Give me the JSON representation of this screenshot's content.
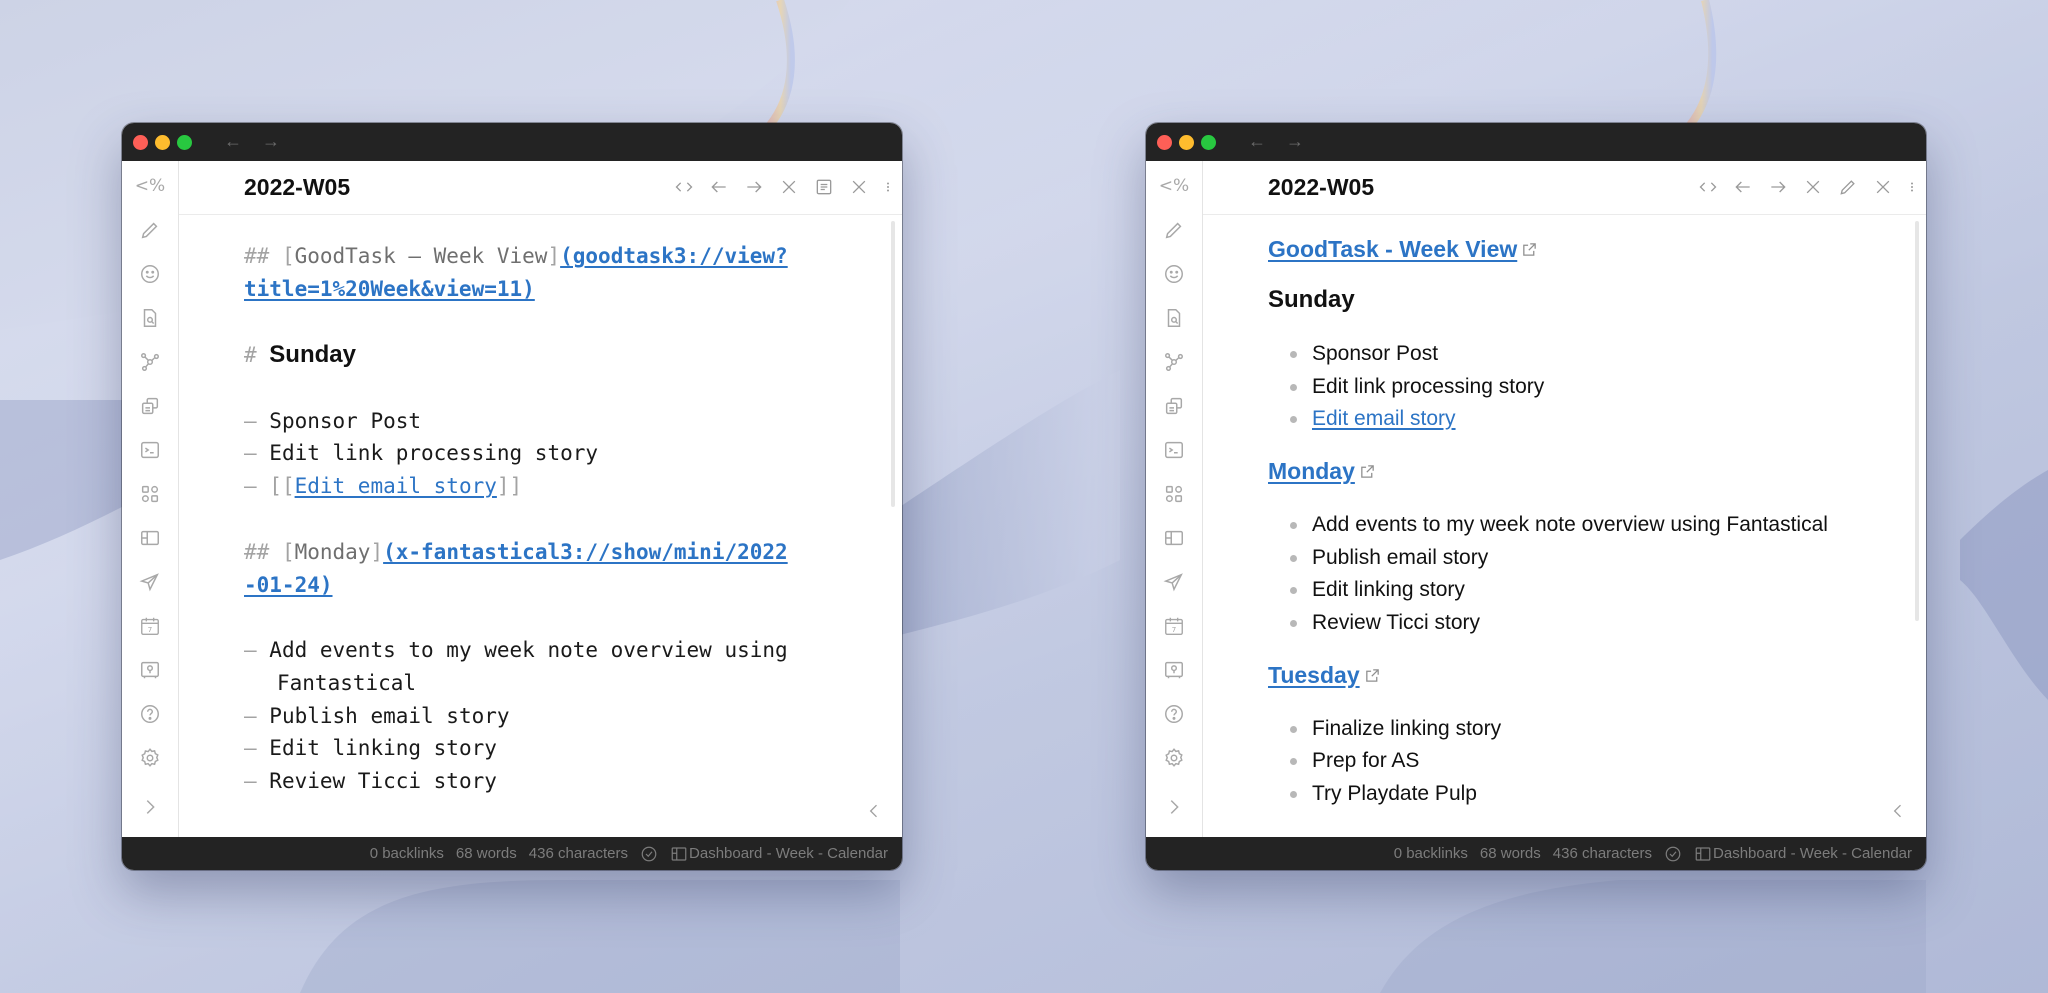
{
  "windows": [
    {
      "mode": "source",
      "titlebar": {
        "back": "←",
        "forward": "→"
      },
      "note_title": "2022-W05",
      "header_actions": [
        "code-toggle",
        "back",
        "forward",
        "close",
        "reading-view",
        "close",
        "more"
      ],
      "source_lines": {
        "l1_prefix": "## ",
        "l1_open": "[",
        "l1_text": "GoodTask – Week View",
        "l1_close": "]",
        "l1_url_a": "(goodtask3://view?",
        "l2_url_b": "title=1%20Week&view=11)",
        "h1_marker": "# ",
        "h1_text": "Sunday",
        "dash": "– ",
        "sun_items": [
          "Sponsor Post",
          "Edit link processing story"
        ],
        "wikilink_open": "[[",
        "wikilink_text": "Edit email story",
        "wikilink_close": "]]",
        "mon_prefix": "## ",
        "mon_open": "[",
        "mon_text": "Monday",
        "mon_close": "]",
        "mon_url_a": "(x-fantastical3://show/mini/2022",
        "mon_url_b": "-01-24)",
        "mon_items": [
          "Add events to my week note overview using",
          "Fantastical",
          "Publish email story",
          "Edit linking story",
          "Review Ticci story"
        ]
      }
    },
    {
      "mode": "preview",
      "titlebar": {
        "back": "←",
        "forward": "→"
      },
      "note_title": "2022-W05",
      "header_actions": [
        "code-toggle",
        "back",
        "forward",
        "close",
        "edit",
        "close",
        "more"
      ],
      "preview": {
        "goodtask_link": "GoodTask - Week View",
        "sunday_heading": "Sunday",
        "sunday_items": [
          "Sponsor Post",
          "Edit link processing story"
        ],
        "sunday_link_item": "Edit email story",
        "monday_heading": "Monday",
        "monday_items": [
          "Add events to my week note overview using Fantastical",
          "Publish email story",
          "Edit linking story",
          "Review Ticci story"
        ],
        "tuesday_heading": "Tuesday",
        "tuesday_items": [
          "Finalize linking story",
          "Prep for AS",
          "Try Playdate Pulp"
        ]
      }
    }
  ],
  "sidebar": {
    "items": [
      {
        "icon": "templater-icon",
        "label": "<%"
      },
      {
        "icon": "pencil-icon"
      },
      {
        "icon": "smiley-icon"
      },
      {
        "icon": "file-search-icon"
      },
      {
        "icon": "graph-icon"
      },
      {
        "icon": "copy-icon"
      },
      {
        "icon": "terminal-icon"
      },
      {
        "icon": "apps-icon"
      },
      {
        "icon": "layout-icon"
      },
      {
        "icon": "send-icon"
      },
      {
        "icon": "calendar-icon",
        "label": "7"
      },
      {
        "icon": "vault-icon"
      },
      {
        "icon": "help-icon"
      },
      {
        "icon": "settings-icon"
      },
      {
        "icon": "expand-icon"
      }
    ]
  },
  "status": {
    "backlinks": "0 backlinks",
    "words": "68 words",
    "characters": "436 characters",
    "layout": "Dashboard - Week - Calendar"
  },
  "colors": {
    "link": "#2c74c5",
    "titlebar": "#232323",
    "close": "#fe5f57",
    "minimize": "#febc2e",
    "maximize": "#28c840"
  }
}
